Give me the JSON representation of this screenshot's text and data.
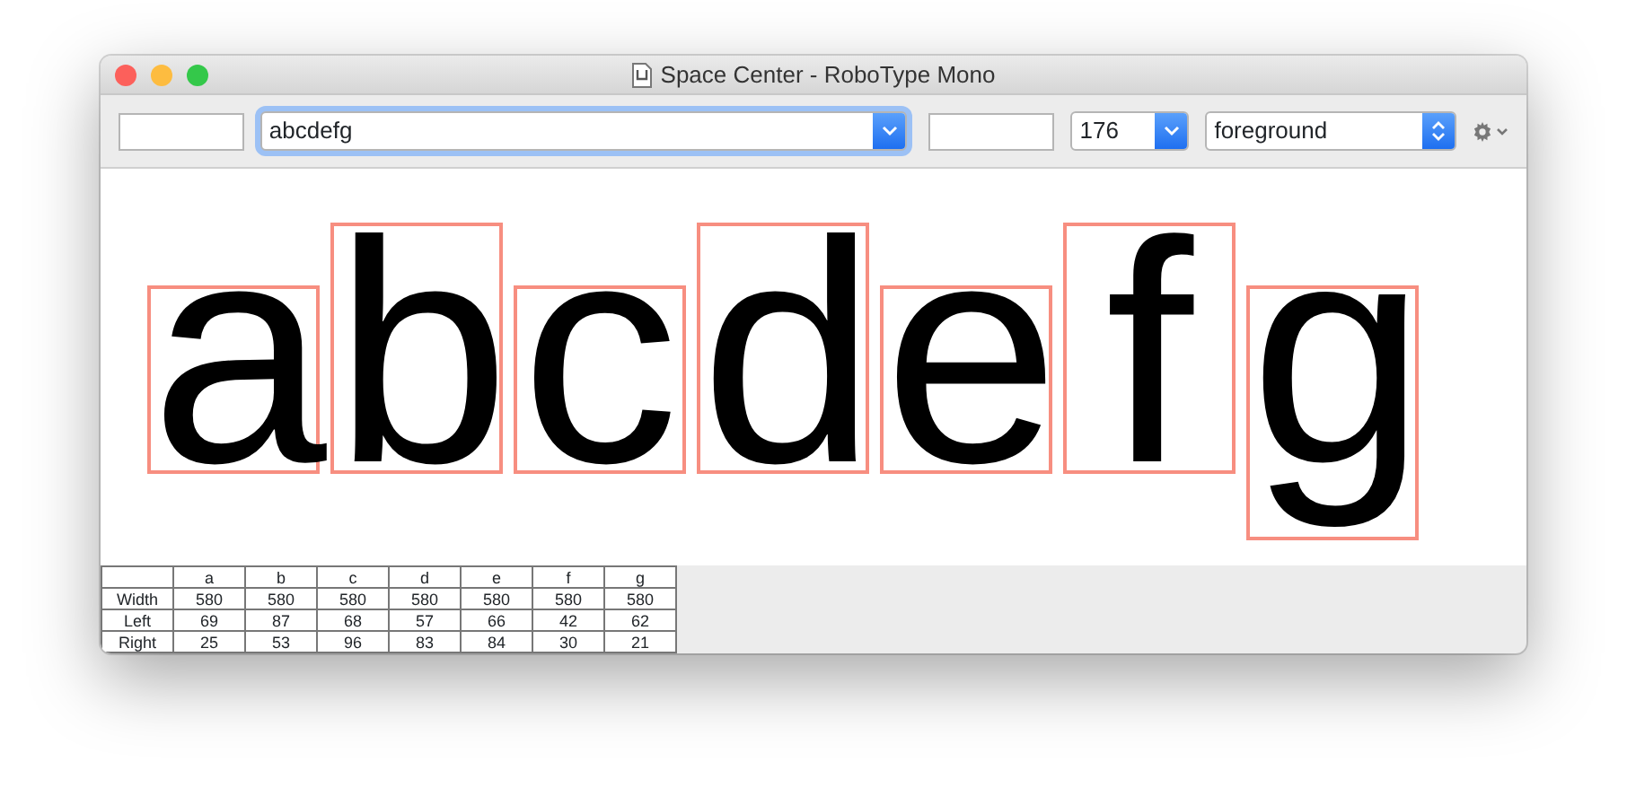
{
  "window": {
    "title": "Space Center - RoboType Mono"
  },
  "toolbar": {
    "text_combo": {
      "value": "abcdefg",
      "focused": true
    },
    "size_combo": {
      "value": "176"
    },
    "layer_popup": {
      "value": "foreground"
    }
  },
  "glyphs": [
    {
      "char": "a",
      "kind": "xheight"
    },
    {
      "char": "b",
      "kind": "ascender"
    },
    {
      "char": "c",
      "kind": "xheight"
    },
    {
      "char": "d",
      "kind": "ascender"
    },
    {
      "char": "e",
      "kind": "xheight"
    },
    {
      "char": "f",
      "kind": "ascender"
    },
    {
      "char": "g",
      "kind": "descender"
    }
  ],
  "metrics": {
    "columns": [
      "a",
      "b",
      "c",
      "d",
      "e",
      "f",
      "g"
    ],
    "rows": [
      {
        "label": "Width",
        "values": [
          "580",
          "580",
          "580",
          "580",
          "580",
          "580",
          "580"
        ]
      },
      {
        "label": "Left",
        "values": [
          "69",
          "87",
          "68",
          "57",
          "66",
          "42",
          "62"
        ]
      },
      {
        "label": "Right",
        "values": [
          "25",
          "53",
          "96",
          "83",
          "84",
          "30",
          "21"
        ]
      }
    ]
  }
}
